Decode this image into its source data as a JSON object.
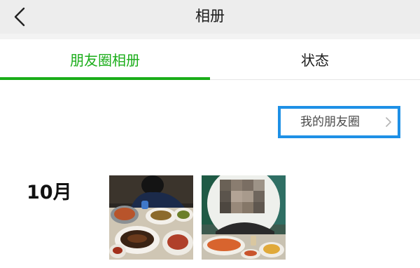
{
  "navbar": {
    "title": "相册",
    "back_icon": "chevron-left-icon"
  },
  "tabs": [
    {
      "label": "朋友圈相册",
      "active": true
    },
    {
      "label": "状态",
      "active": false
    }
  ],
  "moments_link": {
    "label": "我的朋友圈",
    "icon": "chevron-right-icon"
  },
  "album": {
    "sections": [
      {
        "month": "10月",
        "photos": [
          {
            "subject": "dinner table with dishes"
          },
          {
            "subject": "dinner table with person (blurred)"
          }
        ]
      }
    ]
  },
  "colors": {
    "accent": "#1aad19",
    "highlight_border": "#1e90e6",
    "navbar_bg": "#ededed"
  }
}
